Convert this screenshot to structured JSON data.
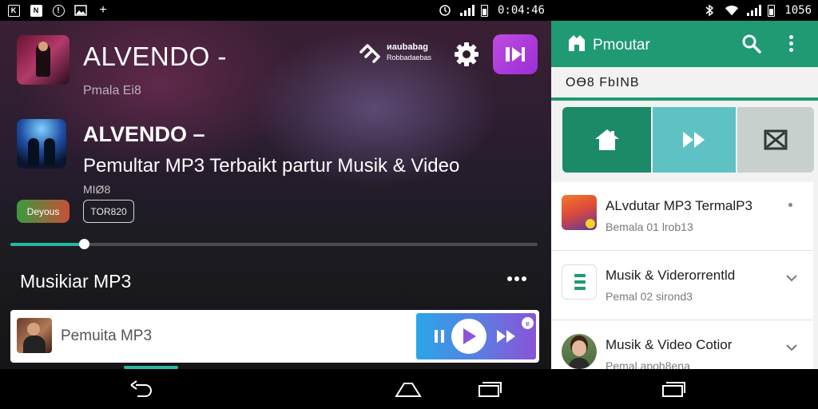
{
  "status_left": {
    "icons": [
      "k-icon",
      "n-icon",
      "alert-icon",
      "image-icon",
      "plus-icon"
    ],
    "box_k": "K",
    "box_n": "N",
    "alert": "!",
    "plus": "+",
    "time": "0:04:46"
  },
  "status_right": {
    "time": "1056"
  },
  "player": {
    "header_title": "ALVENDO -",
    "header_subtitle": "Pmala Ei8",
    "cast_label_line1": "иaubabag",
    "cast_label_line2": "Robbadaebas",
    "track_title": "ALVENDO –",
    "track_subtitle": "Pemultar MP3 Terbaikt partur Musik & Video",
    "track_meta": "MIØ8",
    "badge_green": "Deyous",
    "badge_outline": "ТOR820",
    "progress": 0.14,
    "section_title": "Musikiar MP3",
    "mini_label": "Pemuita MP3",
    "mini_badge": "e"
  },
  "right": {
    "app_title": "Pmoutar",
    "stat_text": "ОӨ8 FbINB",
    "list": [
      {
        "title": "ALvdutar MP3 TermalP3",
        "subtitle": "Bemala 01 lrob13",
        "trailing": "dot"
      },
      {
        "title": "Musik & Viderorrentld",
        "subtitle": "Pemal 02 sirond3",
        "trailing": "chevron"
      },
      {
        "title": "Musik & Video Cotior",
        "subtitle": "Pemal apoh8ena",
        "trailing": "chevron"
      }
    ]
  },
  "colors": {
    "accent_green": "#1f9a72",
    "seek_teal": "#27b7a2",
    "purple_button": "#b13ee0"
  }
}
